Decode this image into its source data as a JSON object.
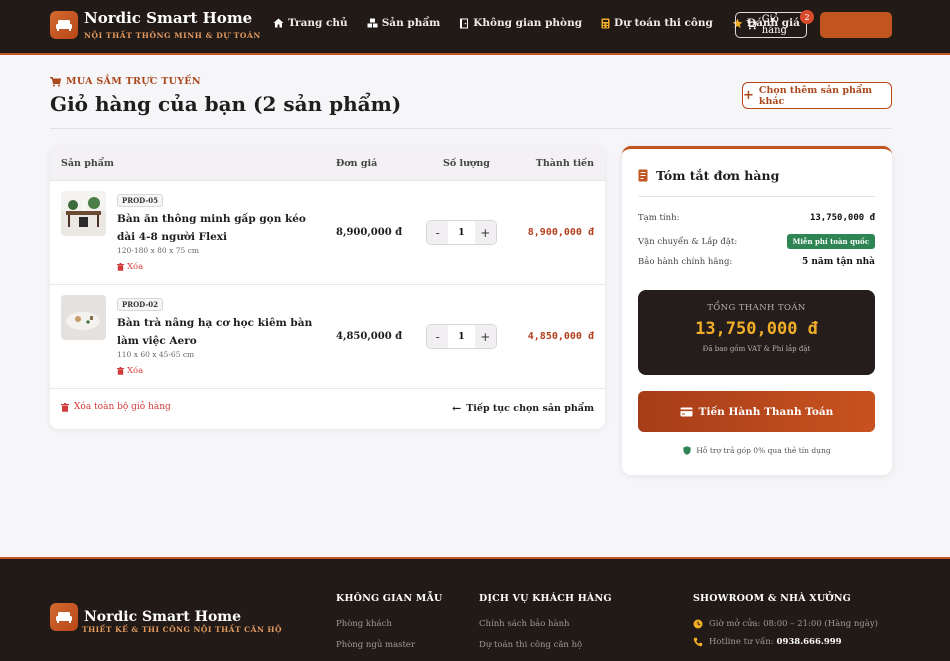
{
  "brand": {
    "name": "Nordic Smart Home",
    "tagline": "NỘI THẤT THÔNG MINH & DỰ TOÁN"
  },
  "nav": {
    "items": [
      {
        "label": "Trang chủ",
        "icon": "home-icon"
      },
      {
        "label": "Sản phẩm",
        "icon": "cubes-icon"
      },
      {
        "label": "Không gian phòng",
        "icon": "door-icon"
      },
      {
        "label": "Dự toán thi công",
        "icon": "calculator-icon"
      },
      {
        "label": "Đánh giá",
        "icon": "star-icon"
      }
    ],
    "cart_label": "Giỏ hàng",
    "cart_count": "2"
  },
  "page": {
    "eyebrow": "MUA SẮM TRỰC TUYẾN",
    "title": "Giỏ hàng của bạn (2 sản phẩm)",
    "add_more_label": "Chọn thêm sản phẩm khác"
  },
  "cart": {
    "headers": {
      "product": "Sản phẩm",
      "unit_price": "Đơn giá",
      "quantity": "Số lượng",
      "line_total": "Thành tiền"
    },
    "items": [
      {
        "code": "PROD-05",
        "name": "Bàn ăn thông minh gấp gọn kéo dài 4-8 người Flexi",
        "dimensions": "120-180 x 80 x 75 cm",
        "remove_label": "Xóa",
        "unit_price": "8,900,000 đ",
        "quantity": "1",
        "line_total": "8,900,000 đ"
      },
      {
        "code": "PROD-02",
        "name": "Bàn trà nâng hạ cơ học kiêm bàn làm việc Aero",
        "dimensions": "110 x 60 x 45-65 cm",
        "remove_label": "Xóa",
        "unit_price": "4,850,000 đ",
        "quantity": "1",
        "line_total": "4,850,000 đ"
      }
    ],
    "minus_label": "-",
    "plus_label": "+",
    "clear_all_label": "Xóa toàn bộ giỏ hàng",
    "continue_label": "Tiếp tục chọn sản phẩm"
  },
  "summary": {
    "title": "Tóm tắt đơn hàng",
    "subtotal_label": "Tạm tính:",
    "subtotal_value": "13,750,000 đ",
    "shipping_label": "Vận chuyển & Lắp đặt:",
    "shipping_value": "Miễn phí toàn quốc",
    "warranty_label": "Bảo hành chính hãng:",
    "warranty_value": "5 năm tận nhà",
    "total_label": "TỔNG THANH TOÁN",
    "total_value": "13,750,000 đ",
    "total_note": "Đã bao gồm VAT & Phí lắp đặt",
    "checkout_label": "Tiến Hành Thanh Toán",
    "installment_note": "Hỗ trợ trả góp 0% qua thẻ tín dụng"
  },
  "footer": {
    "brand_name": "Nordic Smart Home",
    "brand_tagline": "THIẾT KẾ & THI CÔNG NỘI THẤT CĂN HỘ",
    "col1_title": "KHÔNG GIAN MẪU",
    "col1_links": [
      "Phòng khách",
      "Phòng ngủ master"
    ],
    "col2_title": "DỊCH VỤ KHÁCH HÀNG",
    "col2_links": [
      "Chính sách bảo hành",
      "Dự toán thi công căn hộ"
    ],
    "col3_title": "SHOWROOM & NHÀ XƯỞNG",
    "hours": "Giờ mở cửa: 08:00 – 21:00 (Hàng ngày)",
    "hotline_label": "Hotline tư vấn:",
    "hotline_value": "0938.666.999"
  },
  "colors": {
    "accent": "#c2541f",
    "dark": "#221a17",
    "price": "#b3401d",
    "total_gold": "#f0ad28",
    "danger": "#d23b3b",
    "success": "#2e8553"
  }
}
